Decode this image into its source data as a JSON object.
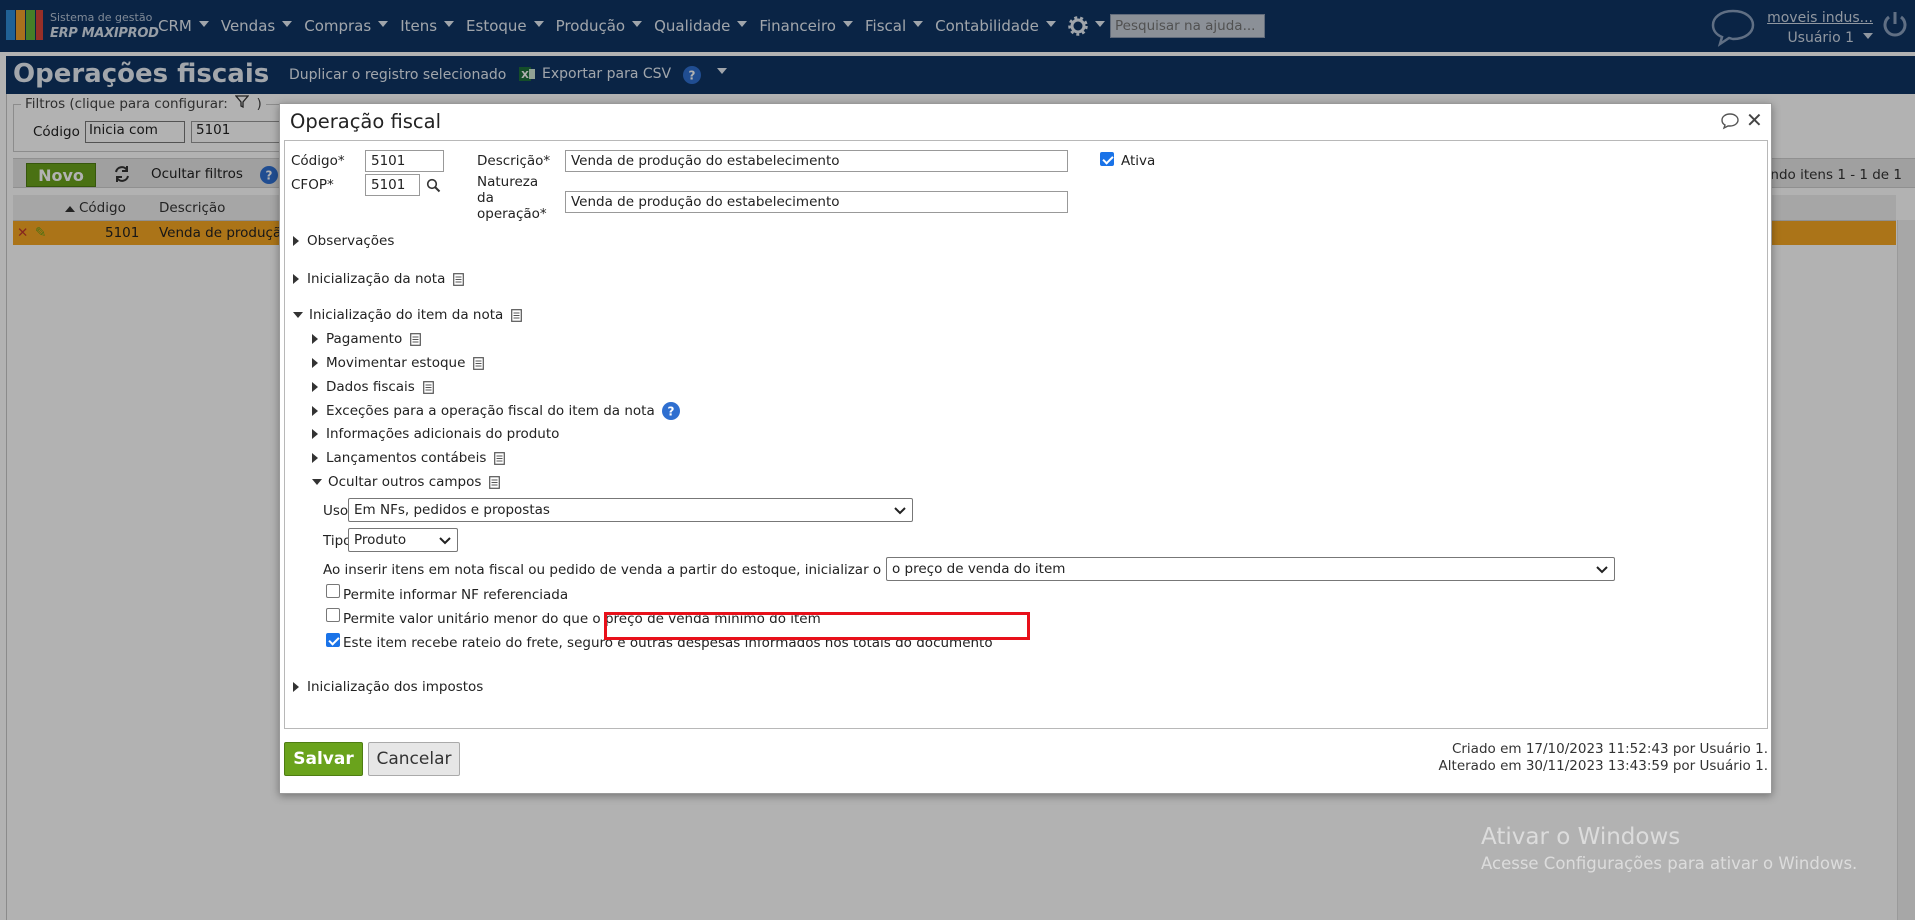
{
  "app": {
    "logo_line1": "Sistema de gestão",
    "logo_line2": "ERP MAXIPROD",
    "menu": [
      "CRM",
      "Vendas",
      "Compras",
      "Itens",
      "Estoque",
      "Produção",
      "Qualidade",
      "Financeiro",
      "Fiscal",
      "Contabilidade"
    ],
    "help_search_placeholder": "Pesquisar na ajuda...",
    "company_link": "moveis indus...",
    "user_name": "Usuário 1"
  },
  "page": {
    "title": "Operações fiscais",
    "duplicate_label": "Duplicar o registro selecionado",
    "export_csv_label": "Exportar para CSV",
    "filters_legend": "Filtros (clique para configurar:",
    "filters_legend_end": ")",
    "filter_code_label": "Código",
    "filter_operator": "Inicia com",
    "filter_value": "5101",
    "new_button": "Novo",
    "hide_filters": "Ocultar filtros",
    "paging": "ndo itens 1 - 1 de 1",
    "grid_columns": [
      "Código",
      "Descrição"
    ],
    "grid_row": {
      "code": "5101",
      "description": "Venda de produção"
    }
  },
  "dialog": {
    "title": "Operação fiscal",
    "code_label": "Código*",
    "code_value": "5101",
    "description_label": "Descrição*",
    "description_value": "Venda de produção do estabelecimento",
    "active_label": "Ativa",
    "active_checked": true,
    "cfop_label": "CFOP*",
    "cfop_value": "5101",
    "nature_label_1": "Natureza",
    "nature_label_2": "da",
    "nature_label_3": "operação*",
    "nature_value": "Venda de produção do estabelecimento",
    "sections": {
      "observacoes": "Observações",
      "init_nota": "Inicialização da nota",
      "init_item": "Inicialização do item da nota",
      "pagamento": "Pagamento",
      "movimentar": "Movimentar estoque",
      "dados_fiscais": "Dados fiscais",
      "excecoes": "Exceções para a operação fiscal do item da nota",
      "info_adic": "Informações adicionais do produto",
      "lancamentos": "Lançamentos contábeis",
      "ocultar": "Ocultar outros campos",
      "init_impostos": "Inicialização dos impostos"
    },
    "uso_label": "Uso",
    "uso_value": "Em NFs, pedidos e propostas",
    "tipo_label": "Tipo",
    "tipo_value": "Produto",
    "unit_value_label": "Ao inserir itens em nota fiscal ou pedido de venda a partir do estoque, inicializar o valor unitário com:",
    "unit_value_select": "o preço de venda do item",
    "chk_nf_ref": "Permite informar NF referenciada",
    "chk_nf_ref_checked": false,
    "chk_min_price": "Permite valor unitário menor do que o preço de venda mínimo do item",
    "chk_min_price_checked": false,
    "chk_rateio": "Este item recebe rateio do frete, seguro e outras despesas informados nos totais do documento",
    "chk_rateio_checked": true,
    "highlight_color": "#e8101a",
    "save_label": "Salvar",
    "cancel_label": "Cancelar",
    "created": "Criado em 17/10/2023 11:52:43 por Usuário 1.",
    "modified": "Alterado em 30/11/2023 13:43:59 por Usuário 1."
  },
  "watermark": {
    "line1": "Ativar o Windows",
    "line2": "Acesse Configurações para ativar o Windows."
  },
  "colors": {
    "nav_bg": "#0f3463",
    "primary_green": "#6aa31c",
    "selected_row": "#f5a623",
    "checkbox_on": "#1a73e8"
  }
}
